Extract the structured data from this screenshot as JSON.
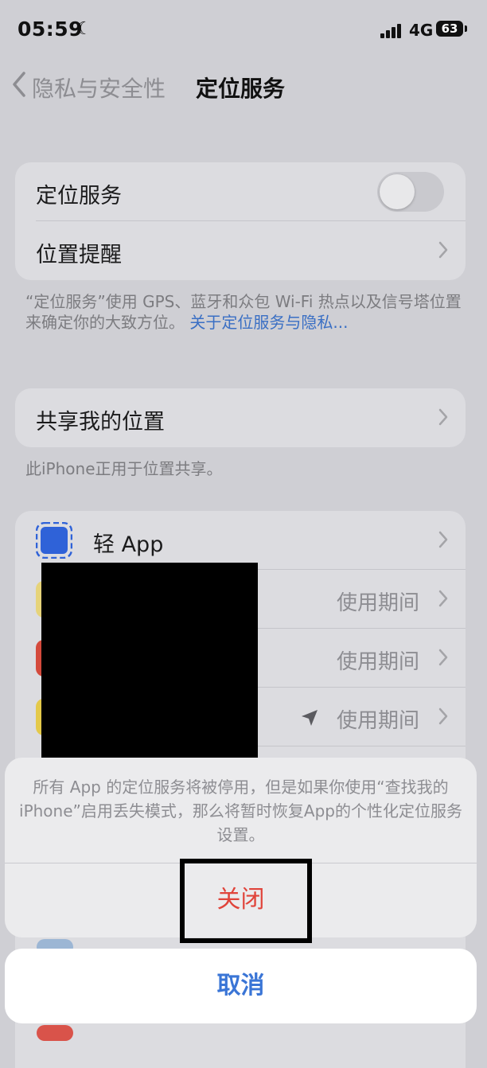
{
  "status": {
    "time": "05:59",
    "network": "4G",
    "battery": "63"
  },
  "nav": {
    "back_label": "隐私与安全性",
    "title": "定位服务"
  },
  "group1": {
    "location_services": "定位服务",
    "location_reminders": "位置提醒"
  },
  "footnote1": {
    "text": "“定位服务”使用 GPS、蓝牙和众包 Wi-Fi 热点以及信号塔位置来确定你的大致方位。",
    "link": "关于定位服务与隐私..."
  },
  "group2": {
    "share_location": "共享我的位置"
  },
  "footnote2": "此iPhone正用于位置共享。",
  "apps": [
    {
      "name": "轻 App",
      "value": ""
    },
    {
      "name": "",
      "value": "使用期间"
    },
    {
      "name": "",
      "value": "使用期间"
    },
    {
      "name": "",
      "value": "使用期间"
    }
  ],
  "sheet": {
    "message": "所有 App 的定位服务将被停用，但是如果你使用“查找我的iPhone”启用丢失模式，那么将暂时恢复App的个性化定位服务设置。",
    "action": "关闭",
    "cancel": "取消"
  },
  "colors": {
    "accent": "#3a75d6",
    "destructive": "#e0443b",
    "app_icon": "#2f62d8"
  }
}
